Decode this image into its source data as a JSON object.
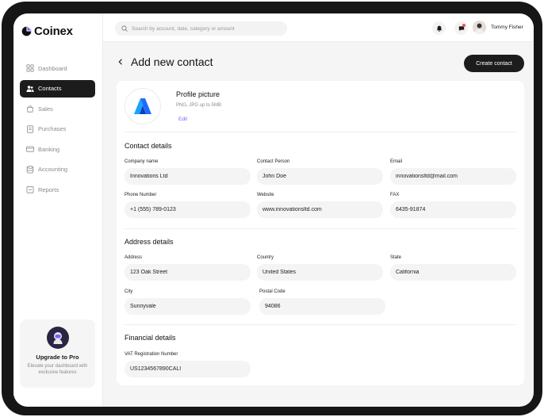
{
  "app": {
    "name": "Coinex"
  },
  "sidebar": {
    "items": [
      {
        "label": "Dashboard",
        "icon": "dashboard-icon",
        "active": false
      },
      {
        "label": "Contacts",
        "icon": "users-icon",
        "active": true
      },
      {
        "label": "Sales",
        "icon": "bag-icon",
        "active": false
      },
      {
        "label": "Purchases",
        "icon": "receipt-icon",
        "active": false
      },
      {
        "label": "Banking",
        "icon": "card-icon",
        "active": false
      },
      {
        "label": "Accounting",
        "icon": "database-icon",
        "active": false
      },
      {
        "label": "Reports",
        "icon": "report-icon",
        "active": false
      }
    ],
    "upgrade": {
      "title": "Upgrade to Pro",
      "subtitle": "Elevate your dashboard with exclusive features"
    }
  },
  "topbar": {
    "search": {
      "placeholder": "Search by account, date, category or amount",
      "value": ""
    },
    "user": {
      "name": "Tommy Fisher"
    }
  },
  "page": {
    "title": "Add new contact",
    "primary_action": "Create contact"
  },
  "profile": {
    "title": "Profile picture",
    "subtitle": "PNG, JPG up to 5MB",
    "edit": "Edit"
  },
  "sections": {
    "contact": {
      "title": "Contact details",
      "fields": {
        "company": {
          "label": "Company name",
          "value": "Innovations Ltd"
        },
        "person": {
          "label": "Contact Person",
          "value": "John Doe"
        },
        "email": {
          "label": "Email",
          "value": "innovationsltd@mail.com"
        },
        "phone": {
          "label": "Phone Number",
          "value": "+1 (555) 789-0123"
        },
        "website": {
          "label": "Website",
          "value": "www.innovationsltd.com"
        },
        "fax": {
          "label": "FAX",
          "value": "6435-91874"
        }
      }
    },
    "address": {
      "title": "Address details",
      "fields": {
        "address": {
          "label": "Address",
          "value": "123 Oak Street"
        },
        "country": {
          "label": "Country",
          "value": "United States"
        },
        "state": {
          "label": "State",
          "value": "California"
        },
        "city": {
          "label": "City",
          "value": "Sunnyvale"
        },
        "postal": {
          "label": "Postal Code",
          "value": "94086"
        }
      }
    },
    "financial": {
      "title": "Financial details",
      "fields": {
        "vat": {
          "label": "VAT Registration Number",
          "value": "US1234567890CALI"
        }
      }
    }
  },
  "colors": {
    "accent": "#7b61ff",
    "dark": "#1c1c1c",
    "brand_blue": "#1f6bff"
  }
}
